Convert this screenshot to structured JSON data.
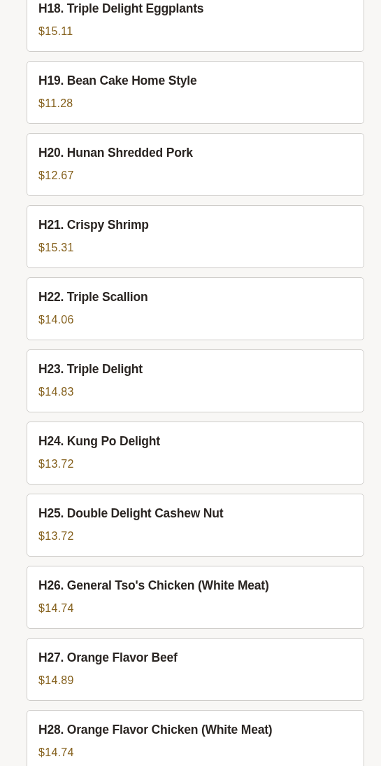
{
  "menu_items": [
    {
      "name": "H18. Triple Delight Eggplants",
      "price": "$15.11"
    },
    {
      "name": "H19. Bean Cake Home Style",
      "price": "$11.28"
    },
    {
      "name": "H20. Hunan Shredded Pork",
      "price": "$12.67"
    },
    {
      "name": "H21. Crispy Shrimp",
      "price": "$15.31"
    },
    {
      "name": "H22. Triple Scallion",
      "price": "$14.06"
    },
    {
      "name": "H23. Triple Delight",
      "price": "$14.83"
    },
    {
      "name": "H24. Kung Po Delight",
      "price": "$13.72"
    },
    {
      "name": "H25. Double Delight Cashew Nut",
      "price": "$13.72"
    },
    {
      "name": "H26. General Tso's Chicken (White Meat)",
      "price": "$14.74"
    },
    {
      "name": "H27. Orange Flavor Beef",
      "price": "$14.89"
    },
    {
      "name": "H28. Orange Flavor Chicken (White Meat)",
      "price": "$14.74"
    }
  ]
}
